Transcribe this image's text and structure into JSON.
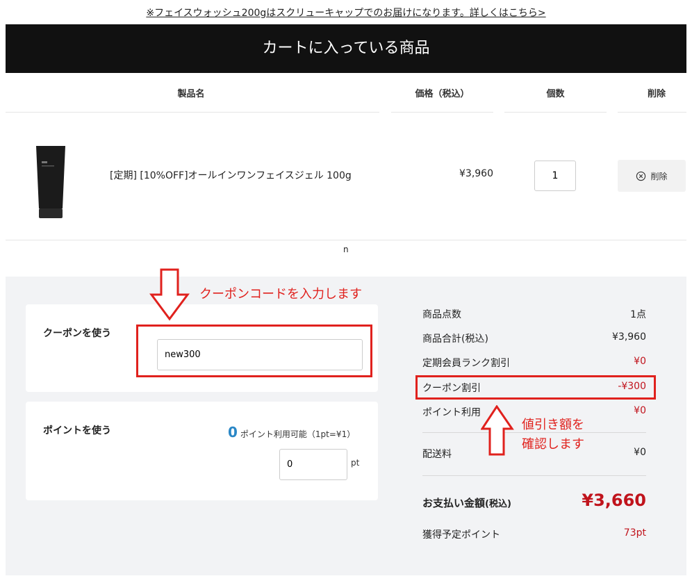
{
  "notice": "※フェイスウォッシュ200gはスクリューキャップでのお届けになります。詳しくはこちら>",
  "header": {
    "title": "カートに入っている商品"
  },
  "table": {
    "columns": [
      "製品名",
      "価格（税込）",
      "個数",
      "削除"
    ],
    "item": {
      "name": "[定期] [10%OFF]オールインワンフェイスジェル 100g",
      "price": "¥3,960",
      "quantity": "1",
      "delete_label": "削除"
    }
  },
  "stray_text": "n",
  "coupon": {
    "title": "クーポンを使う",
    "code": "new300",
    "annotation": "クーポンコードを入力します"
  },
  "points": {
    "title": "ポイントを使う",
    "available": "0",
    "available_label": "ポイント利用可能（1pt=¥1）",
    "input_value": "0",
    "unit": "pt"
  },
  "summary": {
    "rows": [
      {
        "label": "商品点数",
        "value": "1点"
      },
      {
        "label": "商品合計(税込)",
        "value": "¥3,960"
      },
      {
        "label": "定期会員ランク割引",
        "value": "¥0"
      },
      {
        "label": "クーポン割引",
        "value": "-¥300"
      },
      {
        "label": "ポイント利用",
        "value": "¥0"
      },
      {
        "label": "配送料",
        "value": "¥0"
      }
    ],
    "total_label": "お支払い金額",
    "total_tax": "(税込)",
    "total_value": "¥3,660",
    "earn_label": "獲得予定ポイント",
    "earn_value": "73pt",
    "annotation_line1": "値引き額を",
    "annotation_line2": "確認します"
  },
  "colors": {
    "header_bg": "#111111",
    "accent_red": "#c0131c",
    "annotation_red": "#e0211d",
    "points_blue": "#2a87c6"
  }
}
